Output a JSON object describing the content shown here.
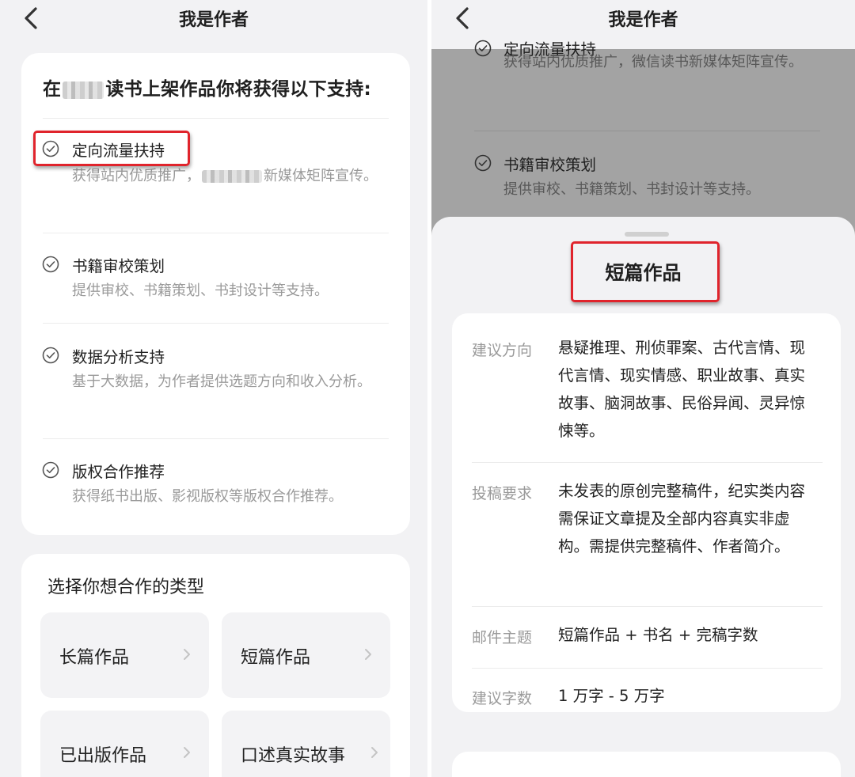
{
  "left": {
    "nav": {
      "title": "我是作者"
    },
    "support": {
      "heading_pre": "在",
      "heading_post": "读书上架作品你将获得以下支持:",
      "items": [
        {
          "title": "定向流量扶持",
          "desc_pre": "获得站内优质推广，",
          "desc_post": "新媒体矩阵宣传。"
        },
        {
          "title": "书籍审校策划",
          "desc": "提供审校、书籍策划、书封设计等支持。"
        },
        {
          "title": "数据分析支持",
          "desc": "基于大数据，为作者提供选题方向和收入分析。"
        },
        {
          "title": "版权合作推荐",
          "desc": "获得纸书出版、影视版权等版权合作推荐。"
        }
      ]
    },
    "types": {
      "heading": "选择你想合作的类型",
      "tiles": [
        "长篇作品",
        "短篇作品",
        "已出版作品",
        "口述真实故事"
      ]
    }
  },
  "right": {
    "nav": {
      "title": "我是作者"
    },
    "background_items": [
      {
        "title": "定向流量扶持",
        "desc": "获得站内优质推广，微信读书新媒体矩阵宣传。"
      },
      {
        "title": "书籍审校策划",
        "desc": "提供审校、书籍策划、书封设计等支持。"
      }
    ],
    "sheet": {
      "title": "短篇作品",
      "rows": [
        {
          "label": "建议方向",
          "value": "悬疑推理、刑侦罪案、古代言情、现代言情、现实情感、职业故事、真实故事、脑洞故事、民俗异闻、灵异惊悚等。"
        },
        {
          "label": "投稿要求",
          "value": "未发表的原创完整稿件，纪实类内容需保证文章提及全部内容真实非虚构。需提供完整稿件、作者简介。"
        },
        {
          "label": "邮件主题",
          "value": "短篇作品 + 书名 + 完稿字数"
        },
        {
          "label": "建议字数",
          "value": "1 万字 - 5 万字"
        }
      ]
    }
  },
  "colors": {
    "highlight": "#e0242c",
    "muted_text": "#9a9a9a",
    "background": "#f2f2f4"
  }
}
